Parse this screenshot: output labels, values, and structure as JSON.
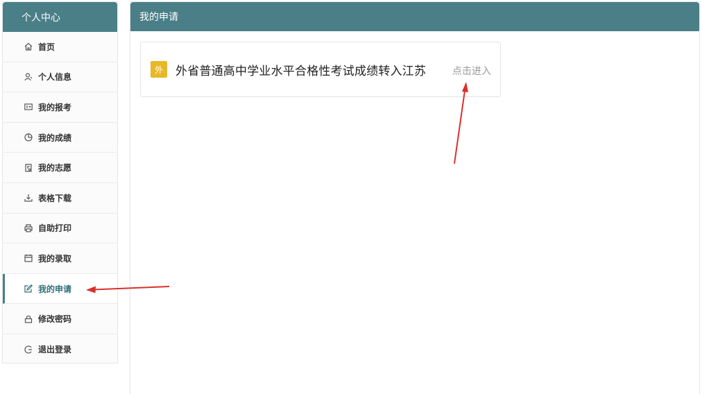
{
  "sidebar": {
    "title": "个人中心",
    "items": [
      {
        "label": "首页",
        "icon": "home-icon"
      },
      {
        "label": "个人信息",
        "icon": "user-icon"
      },
      {
        "label": "我的报考",
        "icon": "id-card-icon"
      },
      {
        "label": "我的成绩",
        "icon": "pie-chart-icon"
      },
      {
        "label": "我的志愿",
        "icon": "document-icon"
      },
      {
        "label": "表格下载",
        "icon": "download-icon"
      },
      {
        "label": "自助打印",
        "icon": "printer-icon"
      },
      {
        "label": "我的录取",
        "icon": "calendar-icon"
      },
      {
        "label": "我的申请",
        "icon": "edit-icon",
        "active": true
      },
      {
        "label": "修改密码",
        "icon": "lock-icon"
      },
      {
        "label": "退出登录",
        "icon": "logout-icon"
      }
    ]
  },
  "main": {
    "title": "我的申请",
    "card": {
      "badge": "外",
      "title": "外省普通高中学业水平合格性考试成绩转入江苏",
      "link": "点击进入"
    }
  },
  "colors": {
    "header": "#4a7f88",
    "badge": "#e8b829",
    "arrow": "#d9302c"
  }
}
